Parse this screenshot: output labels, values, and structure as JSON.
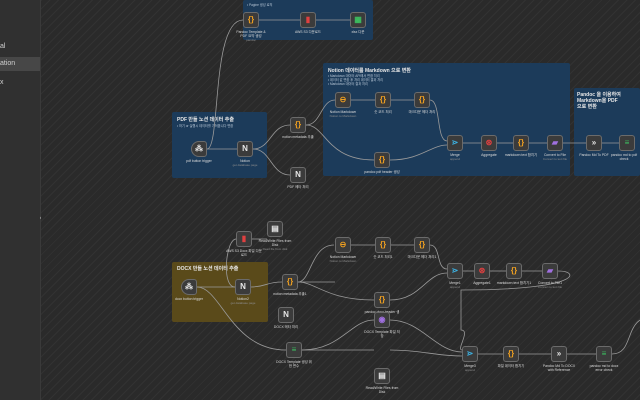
{
  "sidebar": {
    "items": [
      {
        "label": "al",
        "active": false
      },
      {
        "label": "ation",
        "active": true
      },
      {
        "label": "x",
        "active": false
      }
    ],
    "collapse_icon": "‹"
  },
  "stickies": {
    "top": {
      "sub": "• Pagine 생성 로직"
    },
    "pdf": {
      "title": "PDF 만들 노션 데이터 추출",
      "sub": "• 하기 or 실행시 데이터를 가져옵니다 변환"
    },
    "notion": {
      "title": "Notion 데이터를 Markdown 으로 변환",
      "sub1": "• Markdown 데이터 API에서 변환 처리",
      "sub2": "• 데이터 값 변환 후 처리 데이터 결과 처리",
      "sub3": "• Markdown 데이터 결과 처리"
    },
    "pandoc": {
      "title": "Pandoc 을 이용하여 Markdown을 PDF 으로 변환"
    },
    "docx": {
      "title": "DOCX 만들 노션 데이터 추출"
    }
  },
  "nodes": {
    "n1": {
      "label": "Pandoc Template & PDF 요약 생성",
      "sub": "pandoc"
    },
    "n2": {
      "label": "AWS S3 다운로드",
      "sub": ""
    },
    "n3": {
      "label": "xlsx 다운",
      "sub": ""
    },
    "pdf_trigger": {
      "label": "pdf button trigger",
      "sub": ""
    },
    "notion1": {
      "label": "Notion",
      "sub": "get database page"
    },
    "notion_meta1": {
      "label": "notion metadata 추출",
      "sub": ""
    },
    "pdf_meta": {
      "label": "PDF 메타 처리",
      "sub": ""
    },
    "notion_md1": {
      "label": "Notion Markdown",
      "sub": "Notion to Markdown"
    },
    "code_a1": {
      "label": "숫 코드 처리",
      "sub": ""
    },
    "code_b1": {
      "label": "마크다운 헤더 처리",
      "sub": ""
    },
    "pandoc_pdf_header": {
      "label": "pandoc pdf header 생성",
      "sub": ""
    },
    "merge1": {
      "label": "Merge",
      "sub": "append"
    },
    "agg1": {
      "label": "Aggregate",
      "sub": ""
    },
    "mdtext1": {
      "label": "markdown text 합치기",
      "sub": ""
    },
    "convert1": {
      "label": "Convert to File",
      "sub": "Convert to text file"
    },
    "md_to_pdf": {
      "label": "Pandoc Md To PDF",
      "sub": ""
    },
    "pandoc_out": {
      "label": "pandoc md to pdf check",
      "sub": ""
    },
    "aws_docx": {
      "label": "AWS S3 Docx 파일 다운로드",
      "sub": ""
    },
    "rw_files": {
      "label": "Read/Write Files from Disk",
      "sub": "Read file from disk"
    },
    "docx_trigger": {
      "label": "docx button trigger",
      "sub": ""
    },
    "notion2": {
      "label": "Notion2",
      "sub": "get database page"
    },
    "notion_meta2": {
      "label": "notion metadata 추출1",
      "sub": ""
    },
    "docx_meta": {
      "label": "DOCX 메타 처리",
      "sub": ""
    },
    "notion_md2": {
      "label": "Notion Markdown",
      "sub": "Notion to Markdown"
    },
    "code_a2": {
      "label": "숫 코드 처리1",
      "sub": ""
    },
    "code_b2": {
      "label": "마크다운 헤더 처리1",
      "sub": ""
    },
    "pandoc_docx_header": {
      "label": "pandoc docx header 생성",
      "sub": ""
    },
    "merge2": {
      "label": "Merge1",
      "sub": "append"
    },
    "agg2": {
      "label": "Aggregate1",
      "sub": ""
    },
    "mdtext2": {
      "label": "markdown text 합치기1",
      "sub": ""
    },
    "convert2": {
      "label": "Convert to File1",
      "sub": "Convert to text file"
    },
    "docx_template": {
      "label": "DOCX Template 생성 위한 변수",
      "sub": ""
    },
    "docx_template_save": {
      "label": "DOCX Template 파일 저장",
      "sub": ""
    },
    "rw_files2": {
      "label": "Read/Write Files from Disk",
      "sub": ""
    },
    "merge3": {
      "label": "Merge3",
      "sub": "append"
    },
    "code_c": {
      "label": "파일 데이터 합치기",
      "sub": ""
    },
    "md_to_docx": {
      "label": "Pandoc Md To DOCX with Reference",
      "sub": ""
    },
    "pandoc_docx_check": {
      "label": "pandoc md to docx error check",
      "sub": ""
    }
  },
  "colors": {
    "canvas": "#2a2a2a",
    "sticky_blue": "#1c3b5a",
    "sticky_yellow": "#5a4a1a",
    "wire": "#9a9a9a",
    "node_orange": "#f0a020",
    "node_red": "#e04040",
    "node_purple": "#a070e0",
    "node_green": "#3cc060",
    "node_white": "#e8e8e8"
  }
}
